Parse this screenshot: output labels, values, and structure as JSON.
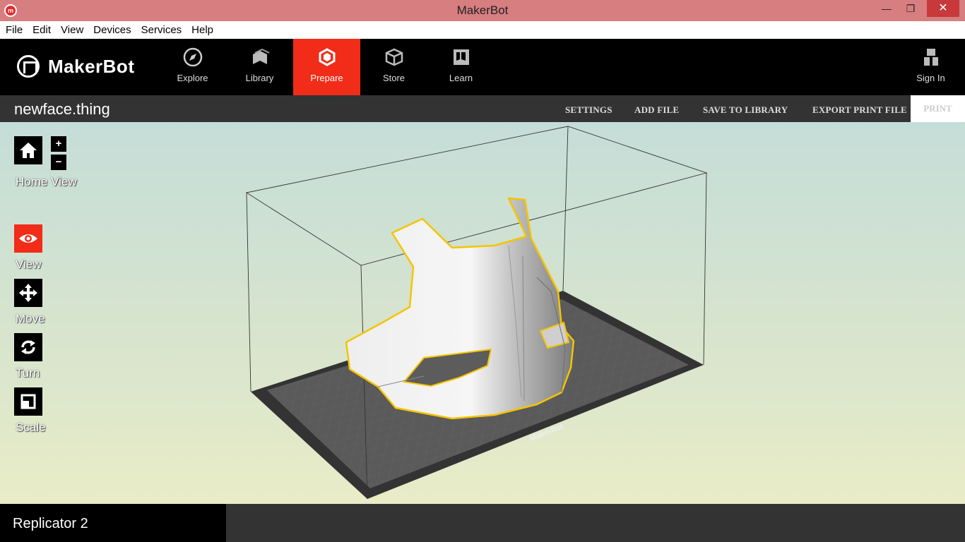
{
  "window": {
    "title": "MakerBot",
    "minimize": "—",
    "maximize": "❐",
    "close": "✕"
  },
  "menu": [
    "File",
    "Edit",
    "View",
    "Devices",
    "Services",
    "Help"
  ],
  "brand": {
    "name": "MakerBot"
  },
  "nav": {
    "tabs": [
      {
        "label": "Explore",
        "icon": "compass-icon"
      },
      {
        "label": "Library",
        "icon": "library-icon"
      },
      {
        "label": "Prepare",
        "icon": "prepare-icon",
        "active": true
      },
      {
        "label": "Store",
        "icon": "store-box-icon"
      },
      {
        "label": "Learn",
        "icon": "learn-book-icon"
      }
    ],
    "sign_in": "Sign In"
  },
  "file": {
    "name": "newface.thing",
    "actions": [
      "SETTINGS",
      "ADD FILE",
      "SAVE TO LIBRARY",
      "EXPORT PRINT FILE"
    ],
    "print": "PRINT"
  },
  "tools": {
    "home": "Home View",
    "zoom_in": "+",
    "zoom_out": "−",
    "view": "View",
    "move": "Move",
    "turn": "Turn",
    "scale": "Scale"
  },
  "scene": {
    "plate_label": "MakerBot",
    "accent": "#f12c19",
    "outline": "#f5c400"
  },
  "printer": {
    "name": "Replicator 2"
  }
}
